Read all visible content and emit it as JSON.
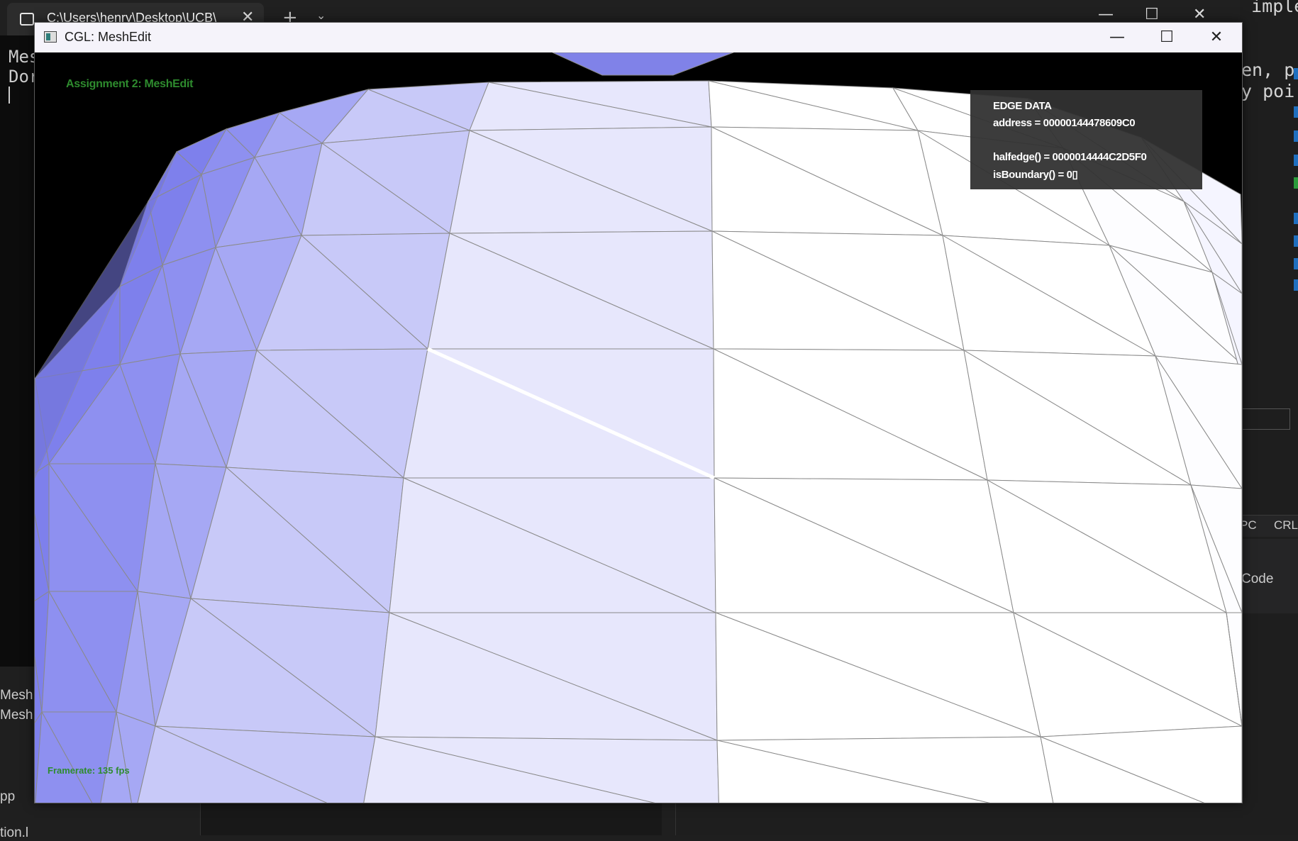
{
  "terminal": {
    "tab_title": "C:\\Users\\henry\\Desktop\\UCB\\",
    "close_glyph": "✕",
    "new_tab_glyph": "+",
    "dropdown_glyph": "⌄",
    "lines": [
      "Mes",
      "Dor"
    ],
    "side_files": [
      "Mesh.c",
      "Mesh.h",
      "pp",
      "tion.l"
    ]
  },
  "right_editor": {
    "code_lines": [
      "g imple",
      "en, p",
      "y poi"
    ],
    "status_items": [
      "PC",
      "CRLF"
    ],
    "code_label": "Code"
  },
  "window": {
    "title": "CGL: MeshEdit",
    "minimize_glyph": "—",
    "maximize_glyph": "☐",
    "close_glyph": "✕"
  },
  "viewer": {
    "assignment_title": "Assignment 2: MeshEdit",
    "framerate": "Framerate: 135 fps",
    "edge_data": {
      "heading": "EDGE DATA",
      "address": "address      = 00000144478609C0",
      "halfedge": "halfedge()    = 0000014444C2D5F0",
      "is_boundary": "isBoundary() = 0▯"
    }
  },
  "colors": {
    "mesh_stroke": "#8a8a8a",
    "selected_edge": "#ffffff",
    "label_green": "#2e8b2e",
    "panel_bg": "#323232"
  }
}
